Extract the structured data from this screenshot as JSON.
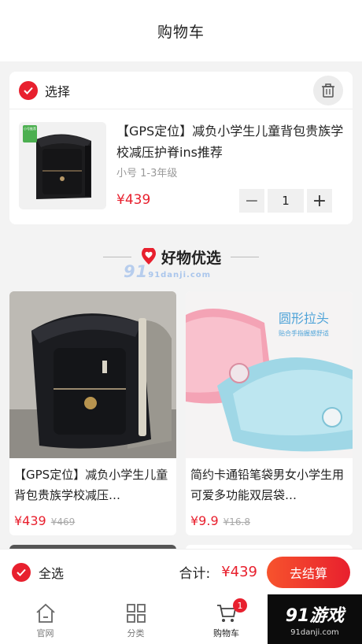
{
  "header": {
    "title": "购物车"
  },
  "cart": {
    "select_label": "选择",
    "item": {
      "title": "【GPS定位】减负小学生儿童背包贵族学校减压护脊ins推荐",
      "spec": "小号 1-3年级",
      "price": "¥439",
      "quantity": "1",
      "minus": "−",
      "plus": "+",
      "thumb_tag": "小号推荐"
    }
  },
  "recommend": {
    "title": "好物优选",
    "products": [
      {
        "name": "【GPS定位】减负小学生儿童背包贵族学校减压…",
        "price": "¥439",
        "old_price": "¥469"
      },
      {
        "name": "简约卡通铅笔袋男女小学生用可爱多功能双层袋…",
        "price": "¥9.9",
        "old_price": "¥16.8",
        "image_text": "圆形拉头",
        "image_subtext": "贴合手指握感舒适"
      }
    ]
  },
  "checkout": {
    "all_label": "全选",
    "total_label": "合计:",
    "total": "¥439",
    "button": "去结算"
  },
  "tabs": [
    {
      "label": "官网",
      "icon": "home-icon"
    },
    {
      "label": "分类",
      "icon": "grid-icon"
    },
    {
      "label": "购物车",
      "icon": "cart-icon",
      "badge": "1"
    }
  ],
  "watermark": {
    "text": "91游戏",
    "domain": "91danji.com",
    "mid_text": "91",
    "mid_domain": "91danji.com"
  },
  "colors": {
    "accent": "#e8202e",
    "background": "#f3f3f3"
  }
}
